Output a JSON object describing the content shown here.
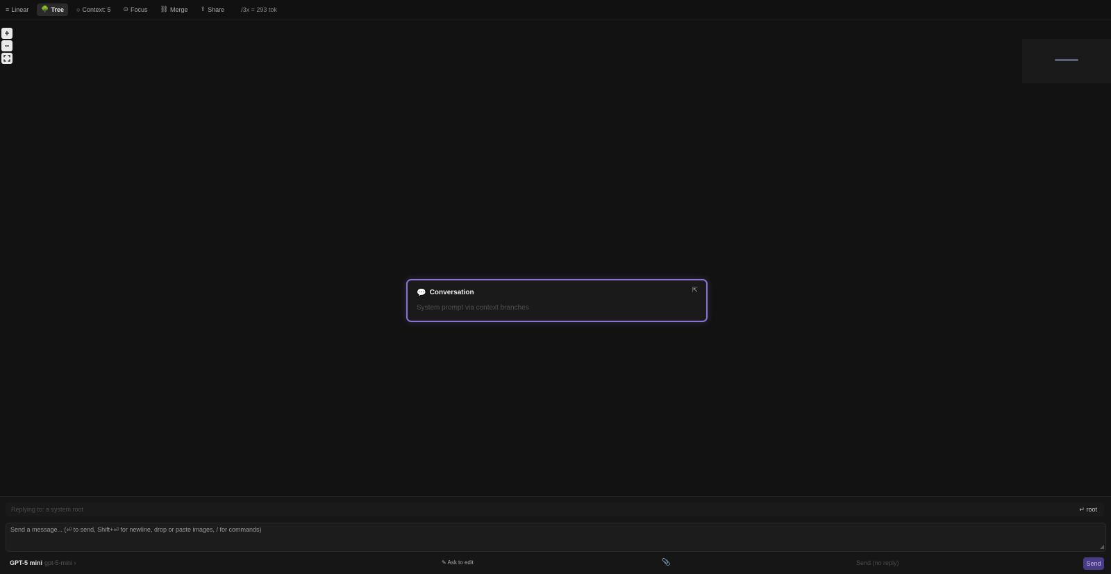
{
  "toolbar": {
    "linear": "Linear",
    "tree": "Tree",
    "context": "Context: 5",
    "focus": "Focus",
    "merge": "Merge",
    "share": "Share",
    "stats": "/3x = 293 tok"
  },
  "zoom": {
    "in": "+",
    "out": "−"
  },
  "node": {
    "title": "Conversation",
    "subtitle": "System prompt via context branches",
    "expand_icon": "expand-icon"
  },
  "composer": {
    "replying_label": "Replying to: a system root",
    "root_button": "↵ root",
    "placeholder": "Send a message... (⏎ to send, Shift+⏎ for newline, drop or paste images, / for commands)",
    "model": "GPT-5 mini",
    "model_sub": "gpt-5-mini ›",
    "ask_edit": "✎ Ask to edit",
    "send_no_reply": "Send (no reply)",
    "send": "Send"
  },
  "colors": {
    "accent": "#8b73d6",
    "background": "#121212",
    "send_bg": "#4a3b86"
  }
}
